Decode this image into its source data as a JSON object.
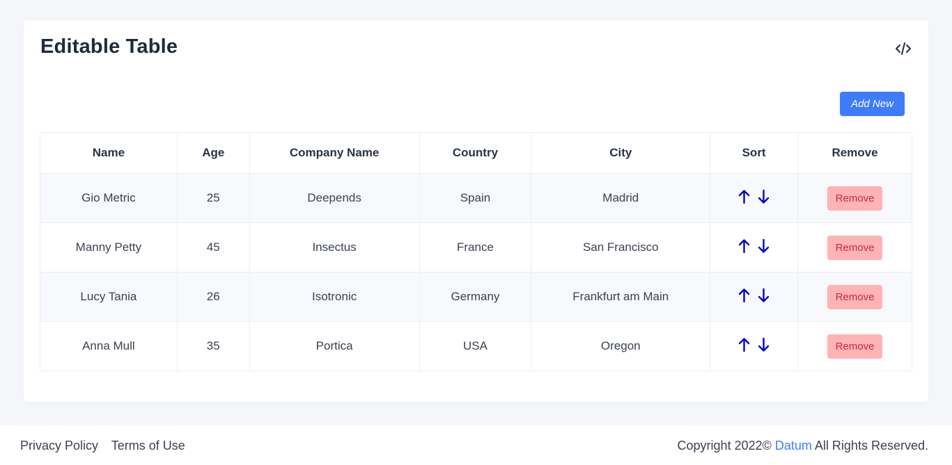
{
  "card": {
    "title": "Editable Table",
    "code_icon": "code-icon",
    "add_button_label": "Add New"
  },
  "table": {
    "columns": [
      "Name",
      "Age",
      "Company Name",
      "Country",
      "City",
      "Sort",
      "Remove"
    ],
    "rows": [
      {
        "name": "Gio Metric",
        "age": "25",
        "company": "Deepends",
        "country": "Spain",
        "city": "Madrid",
        "remove_label": "Remove"
      },
      {
        "name": "Manny Petty",
        "age": "45",
        "company": "Insectus",
        "country": "France",
        "city": "San Francisco",
        "remove_label": "Remove"
      },
      {
        "name": "Lucy Tania",
        "age": "26",
        "company": "Isotronic",
        "country": "Germany",
        "city": "Frankfurt am Main",
        "remove_label": "Remove"
      },
      {
        "name": "Anna Mull",
        "age": "35",
        "company": "Portica",
        "country": "USA",
        "city": "Oregon",
        "remove_label": "Remove"
      }
    ],
    "sort_icons": [
      "arrow-up-icon",
      "arrow-down-icon"
    ]
  },
  "footer": {
    "links": [
      "Privacy Policy",
      "Terms of Use"
    ],
    "copyright_prefix": "Copyright 2022©",
    "brand": "Datum",
    "copyright_suffix": "All Rights Reserved."
  },
  "colors": {
    "accent": "#3f7cfa",
    "remove_bg": "#ffb3b3",
    "remove_text": "#c0303a",
    "arrow": "#0000cc"
  }
}
